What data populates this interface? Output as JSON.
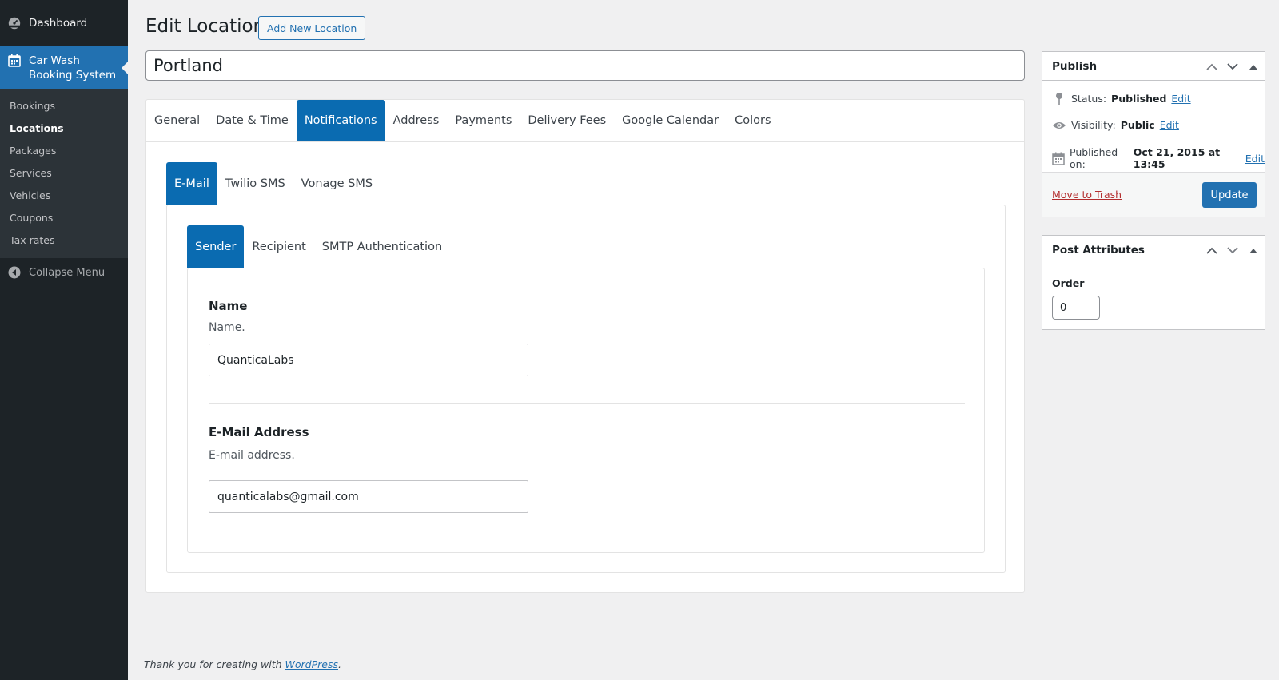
{
  "sidebar": {
    "dashboard": "Dashboard",
    "plugin_line1": "Car Wash",
    "plugin_line2": "Booking System",
    "submenu": [
      "Bookings",
      "Locations",
      "Packages",
      "Services",
      "Vehicles",
      "Coupons",
      "Tax rates"
    ],
    "current_submenu": "Locations",
    "collapse": "Collapse Menu"
  },
  "header": {
    "title": "Edit Location",
    "add_new": "Add New Location"
  },
  "post_title": "Portland",
  "tabs_main": [
    "General",
    "Date & Time",
    "Notifications",
    "Address",
    "Payments",
    "Delivery Fees",
    "Google Calendar",
    "Colors"
  ],
  "tabs_main_active": "Notifications",
  "tabs_notifications": [
    "E-Mail",
    "Twilio SMS",
    "Vonage SMS"
  ],
  "tabs_notifications_active": "E-Mail",
  "tabs_email": [
    "Sender",
    "Recipient",
    "SMTP Authentication"
  ],
  "tabs_email_active": "Sender",
  "fields": {
    "name_label": "Name",
    "name_desc": "Name.",
    "name_value": "QuanticaLabs",
    "email_label": "E-Mail Address",
    "email_desc": "E-mail address.",
    "email_value": "quanticalabs@gmail.com"
  },
  "publish": {
    "title": "Publish",
    "status_label": "Status:",
    "status_value": "Published",
    "visibility_label": "Visibility:",
    "visibility_value": "Public",
    "published_label": "Published on:",
    "published_value": "Oct 21, 2015 at 13:45",
    "edit": "Edit",
    "trash": "Move to Trash",
    "update": "Update"
  },
  "attributes": {
    "title": "Post Attributes",
    "order_label": "Order",
    "order_value": "0"
  },
  "footer": {
    "text": "Thank you for creating with",
    "link": "WordPress",
    "period": "."
  },
  "colors": {
    "sidebar_bg": "#1d2327",
    "accent": "#2271b1",
    "tab_active": "#0a6bb1"
  }
}
